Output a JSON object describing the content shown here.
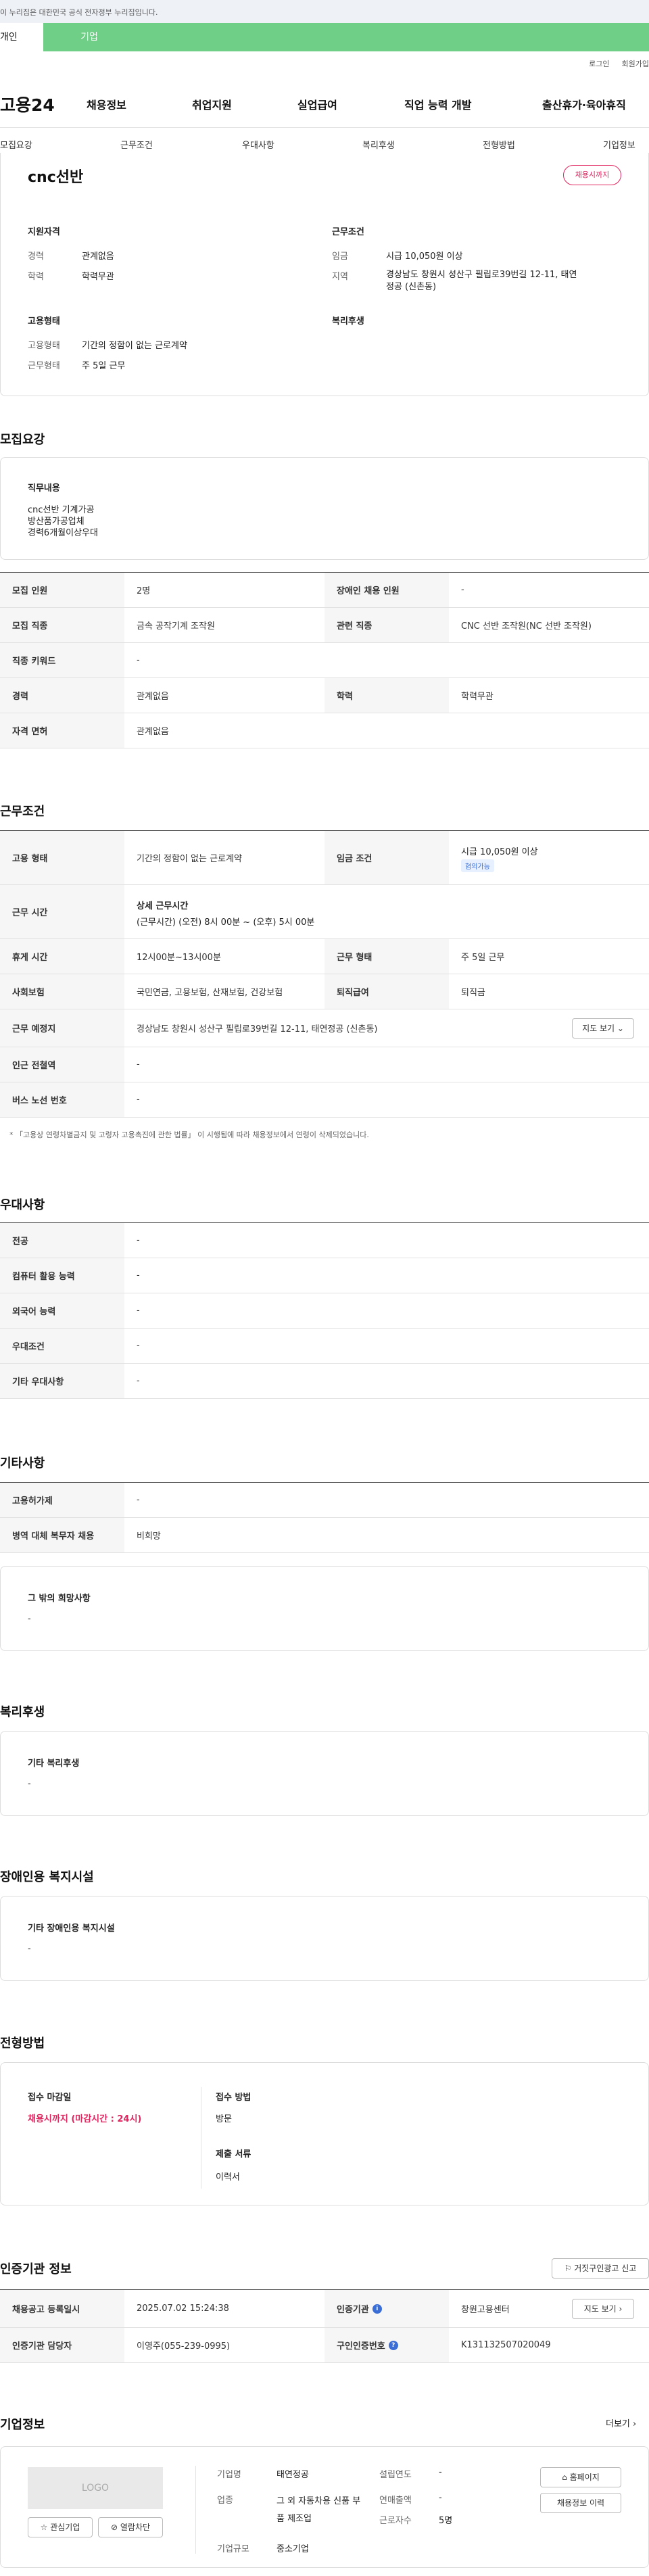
{
  "gov_bar": "이 누리집은 대한민국 공식 전자정부 누리집입니다.",
  "tabs": [
    "개인",
    "기업"
  ],
  "top_links": [
    "로그인",
    "회원가입"
  ],
  "logo": "고용24",
  "gnb": [
    "채용정보",
    "취업지원",
    "실업급여",
    "직업 능력 개발",
    "출산휴가·육아휴직"
  ],
  "anchors": [
    "모집요강",
    "근무조건",
    "우대사항",
    "복리후생",
    "전형방법",
    "기업정보"
  ],
  "summary": {
    "title": "cnc선반",
    "badge": "채용시까지",
    "qual_title": "지원자격",
    "career_label": "경력",
    "career": "관계없음",
    "edu_label": "학력",
    "edu": "학력무관",
    "cond_title": "근무조건",
    "wage_label": "임금",
    "wage": "시급 10,050원 이상",
    "region_label": "지역",
    "region": "경상남도 창원시 성산구 필립로39번길 12-11, 태연정공 (신촌동)",
    "emp_title": "고용형태",
    "emptype_label": "고용형태",
    "emptype": "기간의 정함이 없는 근로계약",
    "workday_label": "근무형태",
    "workday": "주 5일 근무",
    "welfare_title": "복리후생"
  },
  "recruit": {
    "title": "모집요강",
    "duty_title": "직무내용",
    "duty_lines": [
      "cnc선반 기계가공",
      "방산품가공업체",
      "경력6개월이상우대"
    ],
    "rows": [
      [
        "모집 인원",
        "2명",
        "장애인 채용 인원",
        "-"
      ],
      [
        "모집 직종",
        "금속 공작기계 조작원",
        "관련 직종",
        "CNC 선반 조작원(NC 선반 조작원)"
      ],
      [
        "직종 키워드",
        "-"
      ],
      [
        "경력",
        "관계없음",
        "학력",
        "학력무관"
      ],
      [
        "자격 면허",
        "관계없음"
      ]
    ]
  },
  "work": {
    "title": "근무조건",
    "emp_type_h": "고용 형태",
    "emp_type": "기간의 정함이 없는 근로계약",
    "wage_h": "임금 조건",
    "wage": "시급 10,050원 이상",
    "wage_pill": "협의가능",
    "hours_h": "근무 시간",
    "hours_title": "상세 근무시간",
    "hours": "(근무시간) (오전) 8시 00분 ~ (오후) 5시 00분",
    "break_h": "휴게 시간",
    "break": "12시00분~13시00분",
    "form_h": "근무 형태",
    "form": "주 5일 근무",
    "ins_h": "사회보험",
    "ins": "국민연금, 고용보험, 산재보험, 건강보험",
    "ret_h": "퇴직급여",
    "ret": "퇴직금",
    "place_h": "근무 예정지",
    "place": "경상남도 창원시 성산구 필립로39번길 12-11, 태연정공 (신촌동)",
    "map_btn": "지도 보기",
    "subway_h": "인근 전철역",
    "subway": "-",
    "bus_h": "버스 노선 번호",
    "bus": "-",
    "note": "* 「고용상 연령차별금지 및 고령자 고용촉진에 관한 법률」 이 시행됨에 따라 채용정보에서 연령이 삭제되었습니다."
  },
  "pref": {
    "title": "우대사항",
    "rows": [
      [
        "전공",
        "-"
      ],
      [
        "컴퓨터 활용 능력",
        "-"
      ],
      [
        "외국어 능력",
        "-"
      ],
      [
        "우대조건",
        "-"
      ],
      [
        "기타 우대사항",
        "-"
      ]
    ]
  },
  "etc": {
    "title": "기타사항",
    "rows": [
      [
        "고용허가제",
        "-"
      ],
      [
        "병역 대체 복무자 채용",
        "비희망"
      ]
    ],
    "other_title": "그 밖의 희망사항",
    "other": "-"
  },
  "welfare": {
    "title": "복리후생",
    "sub": "기타 복리후생",
    "val": "-"
  },
  "disab": {
    "title": "장애인용 복지시설",
    "sub": "기타 장애인용 복지시설",
    "val": "-"
  },
  "selection": {
    "title": "전형방법",
    "deadline_h": "접수 마감일",
    "deadline": "채용시까지 (마감시간 : 24시)",
    "method_h": "접수 방법",
    "method": "방문",
    "docs_h": "제출 서류",
    "docs": "이력서"
  },
  "cert": {
    "title": "인증기관 정보",
    "report_btn": "거짓구인광고 신고",
    "reg_h": "채용공고 등록일시",
    "reg": "2025.07.02 15:24:38",
    "org_h": "인증기관",
    "org": "창원고용센터",
    "map_btn": "지도 보기",
    "mgr_h": "인증기관 담당자",
    "mgr": "이영주(055-239-0995)",
    "no_h": "구인인증번호",
    "no": "K131132507020049"
  },
  "company": {
    "title": "기업정보",
    "more": "더보기",
    "logo": "LOGO",
    "fav": "관심기업",
    "block": "열람차단",
    "name_h": "기업명",
    "name": "태연정공",
    "found_h": "설립연도",
    "found": "-",
    "biz_h": "업종",
    "biz": "그 외 자동차용 신품 부품 제조업",
    "sales_h": "연매출액",
    "sales": "-",
    "size_h": "기업규모",
    "size": "중소기업",
    "emp_h": "근로자수",
    "emp": "5명",
    "home_btn": "홈페이지",
    "hist_btn": "채용정보 이력"
  }
}
